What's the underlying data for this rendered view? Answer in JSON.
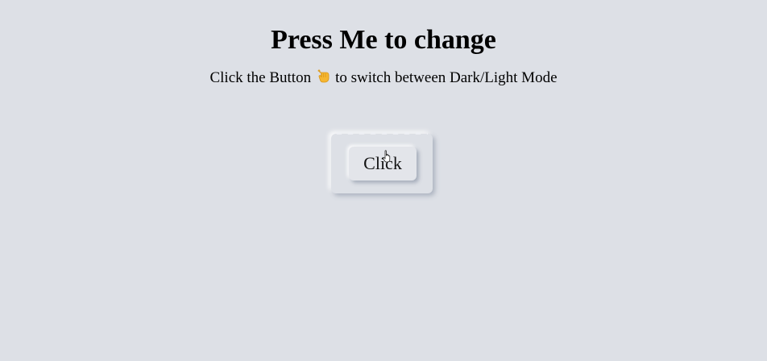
{
  "header": {
    "title": "Press Me to change",
    "subtitle_before": "Click the Button",
    "subtitle_after": "to switch between Dark/Light Mode",
    "pointer_icon": "backhand-index-pointing-down-icon"
  },
  "toggle": {
    "button_label": "Click"
  },
  "colors": {
    "background": "#dde0e6",
    "button_bg": "#e3e5ea",
    "emoji": "#f5b631"
  }
}
